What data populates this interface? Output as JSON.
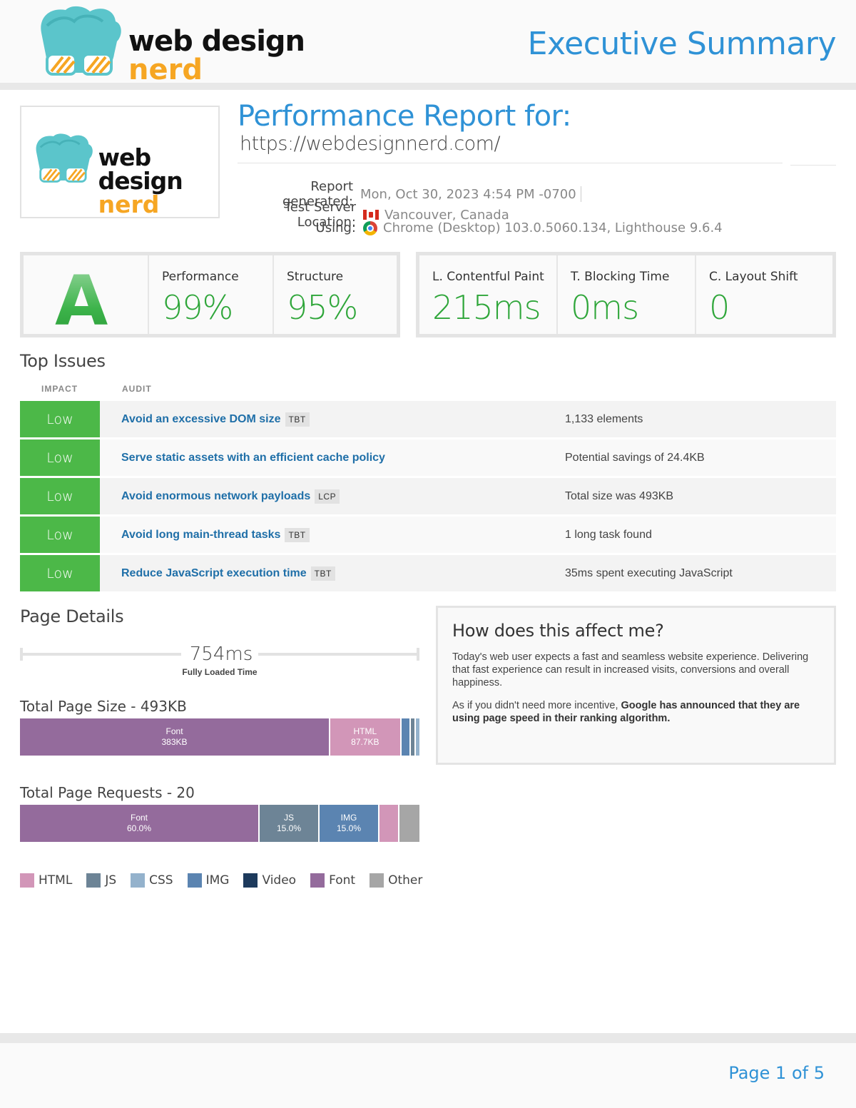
{
  "brand": {
    "logo_line1": "web design",
    "logo_line2": "nerd"
  },
  "header": {
    "title": "Executive Summary"
  },
  "report": {
    "title": "Performance Report for:",
    "url": "https://webdesignnerd.com/",
    "generated_label": "Report generated:",
    "generated_value": "Mon, Oct 30, 2023 4:54 PM -0700",
    "location_label": "Test Server Location:",
    "location_value": "Vancouver, Canada",
    "using_label": "Using:",
    "using_value": "Chrome (Desktop) 103.0.5060.134, Lighthouse 9.6.4"
  },
  "scores": {
    "grade": "A",
    "performance_label": "Performance",
    "performance_value": "99%",
    "structure_label": "Structure",
    "structure_value": "95%",
    "lcp_label": "L. Contentful Paint",
    "lcp_value": "215ms",
    "tbt_label": "T. Blocking Time",
    "tbt_value": "0ms",
    "cls_label": "C. Layout Shift",
    "cls_value": "0",
    "grade_color": "#3db34a"
  },
  "top_issues": {
    "title": "Top Issues",
    "impact_header": "IMPACT",
    "audit_header": "AUDIT",
    "rows": [
      {
        "impact": "Low",
        "audit": "Avoid an excessive DOM size",
        "tag": "TBT",
        "detail": "1,133 elements"
      },
      {
        "impact": "Low",
        "audit": "Serve static assets with an efficient cache policy",
        "tag": "",
        "detail": "Potential savings of 24.4KB"
      },
      {
        "impact": "Low",
        "audit": "Avoid enormous network payloads",
        "tag": "LCP",
        "detail": "Total size was 493KB"
      },
      {
        "impact": "Low",
        "audit": "Avoid long main-thread tasks",
        "tag": "TBT",
        "detail": "1 long task found"
      },
      {
        "impact": "Low",
        "audit": "Reduce JavaScript execution time",
        "tag": "TBT",
        "detail": "35ms spent executing JavaScript"
      }
    ]
  },
  "page_details": {
    "title": "Page Details",
    "fully_loaded_value": "754ms",
    "fully_loaded_label": "Fully Loaded Time",
    "size_title": "Total Page Size - 493KB",
    "requests_title": "Total Page Requests - 20"
  },
  "chart_data": [
    {
      "type": "bar",
      "title": "Total Page Size - 493KB",
      "categories": [
        "Font",
        "HTML",
        "IMG",
        "JS",
        "CSS"
      ],
      "values": [
        383,
        87.7,
        12,
        6,
        4.3
      ],
      "labels": [
        "383KB",
        "87.7KB",
        "",
        "",
        ""
      ],
      "colors": [
        "#946b9c",
        "#d296b8",
        "#5b84b1",
        "#6d8496",
        "#94b2cc"
      ]
    },
    {
      "type": "bar",
      "title": "Total Page Requests - 20",
      "categories": [
        "Font",
        "JS",
        "IMG",
        "HTML",
        "Other"
      ],
      "values": [
        60.0,
        15.0,
        15.0,
        5.0,
        5.0
      ],
      "labels": [
        "60.0%",
        "15.0%",
        "15.0%",
        "",
        ""
      ],
      "colors": [
        "#946b9c",
        "#6d8496",
        "#5b84b1",
        "#d296b8",
        "#a6a6a6"
      ]
    }
  ],
  "legend": [
    {
      "label": "HTML",
      "color": "#d296b8"
    },
    {
      "label": "JS",
      "color": "#6d8496"
    },
    {
      "label": "CSS",
      "color": "#94b2cc"
    },
    {
      "label": "IMG",
      "color": "#5b84b1"
    },
    {
      "label": "Video",
      "color": "#1d3a5c"
    },
    {
      "label": "Font",
      "color": "#946b9c"
    },
    {
      "label": "Other",
      "color": "#a6a6a6"
    }
  ],
  "affect": {
    "title": "How does this affect me?",
    "p1": "Today's web user expects a fast and seamless website experience. Delivering that fast experience can result in increased visits, conversions and overall happiness.",
    "p2_plain": "As if you didn't need more incentive, ",
    "p2_bold": "Google has announced that they are using page speed in their ranking algorithm."
  },
  "footer": {
    "page": "Page 1 of 5"
  }
}
